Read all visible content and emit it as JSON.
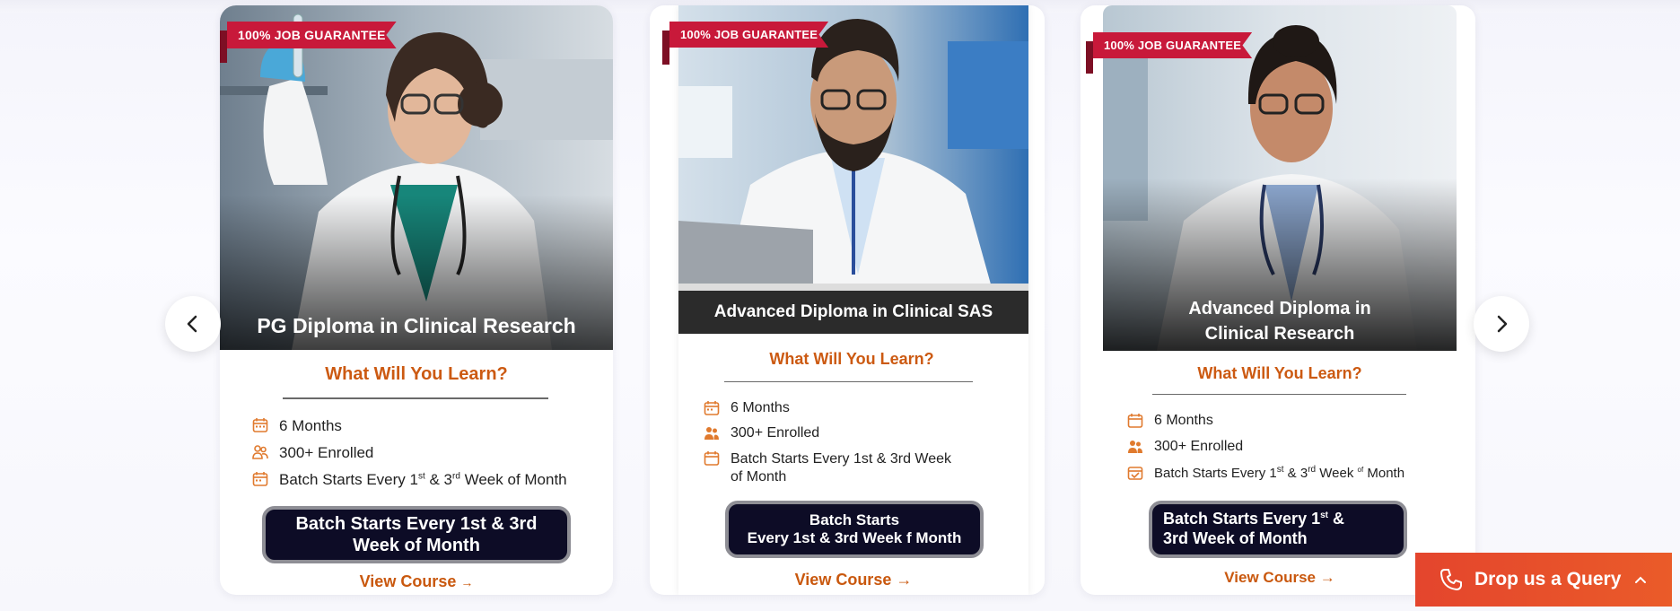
{
  "carousel": {
    "prev_icon": "chevron-left-icon",
    "next_icon": "chevron-right-icon"
  },
  "cards": [
    {
      "badge": "100% JOB GUARANTEE",
      "title": "PG Diploma in Clinical Research",
      "learn_heading": "What Will You Learn?",
      "duration": "6 Months",
      "enrolled": "300+ Enrolled",
      "batch_main": "Batch Starts Every 1",
      "batch_sup1": "st",
      "batch_mid": " & 3",
      "batch_sup2": "rd",
      "batch_end": " Week of Month",
      "cta_line1": "Batch Starts Every 1st & 3rd",
      "cta_line2": "Week of Month",
      "view_course": "View Course"
    },
    {
      "badge": "100% JOB GUARANTEE",
      "title": "Advanced Diploma in Clinical SAS",
      "learn_heading": "What Will You Learn?",
      "duration": "6 Months",
      "enrolled": "300+ Enrolled",
      "batch_line1": "Batch Starts Every 1st & 3rd Week",
      "batch_line2": "of Month",
      "cta_line1": "Batch Starts",
      "cta_line2": "Every 1st & 3rd Week f Month",
      "view_course": "View Course"
    },
    {
      "badge": "100% JOB GUARANTEE",
      "title_line1": "Advanced Diploma in",
      "title_line2": "Clinical Research",
      "learn_heading": "What Will You Learn?",
      "duration": "6 Months",
      "enrolled": "300+ Enrolled",
      "batch_main": "Batch Starts Every 1",
      "batch_sup1": "st",
      "batch_mid": " & 3",
      "batch_sup2": "rd",
      "batch_mid2": " Week ",
      "batch_sup3": "of",
      "batch_end": " Month",
      "cta_line1a": "Batch Starts Every 1",
      "cta_sup": "st",
      "cta_line1b": " &",
      "cta_line2": "3rd Week of Month",
      "view_course": "View Course"
    }
  ],
  "query_button": {
    "label": "Drop us a Query",
    "icon": "phone-icon",
    "toggle_icon": "chevron-up-icon"
  },
  "colors": {
    "accent_orange": "#cc5a12",
    "badge_red": "#c8193a",
    "cta_navy": "#0d0c26",
    "query_orange": "#e64a2c"
  }
}
